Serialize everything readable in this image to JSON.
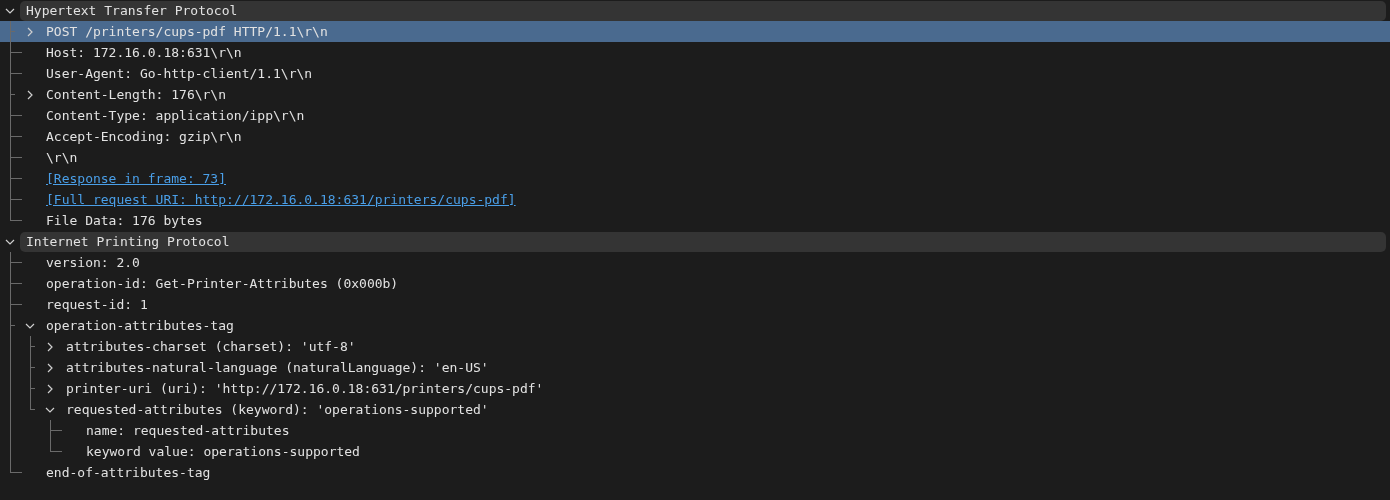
{
  "tree": [
    {
      "label": "Hypertext Transfer Protocol",
      "expanded": true,
      "selected": false,
      "children": [
        {
          "label": "POST /printers/cups-pdf HTTP/1.1\\r\\n",
          "expanded": false,
          "selected": true
        },
        {
          "label": "Host: 172.16.0.18:631\\r\\n",
          "selected": false
        },
        {
          "label": "User-Agent: Go-http-client/1.1\\r\\n",
          "selected": false
        },
        {
          "label": "Content-Length: 176\\r\\n",
          "expanded": false,
          "selected": false
        },
        {
          "label": "Content-Type: application/ipp\\r\\n",
          "selected": false
        },
        {
          "label": "Accept-Encoding: gzip\\r\\n",
          "selected": false
        },
        {
          "label": "\\r\\n",
          "selected": false
        },
        {
          "label": "[Response in frame: 73]",
          "selected": false,
          "kind": "link"
        },
        {
          "label": "[Full request URI: http://172.16.0.18:631/printers/cups-pdf]",
          "selected": false,
          "kind": "link"
        },
        {
          "label": "File Data: 176 bytes",
          "selected": false
        }
      ]
    },
    {
      "label": "Internet Printing Protocol",
      "expanded": true,
      "selected": false,
      "children": [
        {
          "label": "version: 2.0",
          "selected": false
        },
        {
          "label": "operation-id: Get-Printer-Attributes (0x000b)",
          "selected": false
        },
        {
          "label": "request-id: 1",
          "selected": false
        },
        {
          "label": "operation-attributes-tag",
          "expanded": true,
          "selected": false,
          "children": [
            {
              "label": "attributes-charset (charset): 'utf-8'",
              "expanded": false,
              "selected": false
            },
            {
              "label": "attributes-natural-language (naturalLanguage): 'en-US'",
              "expanded": false,
              "selected": false
            },
            {
              "label": "printer-uri (uri): 'http://172.16.0.18:631/printers/cups-pdf'",
              "expanded": false,
              "selected": false
            },
            {
              "label": "requested-attributes (keyword): 'operations-supported'",
              "expanded": true,
              "selected": false,
              "children": [
                {
                  "label": "name: requested-attributes",
                  "selected": false
                },
                {
                  "label": "keyword value: operations-supported",
                  "selected": false
                }
              ]
            }
          ]
        },
        {
          "label": "end-of-attributes-tag",
          "selected": false
        }
      ]
    }
  ]
}
